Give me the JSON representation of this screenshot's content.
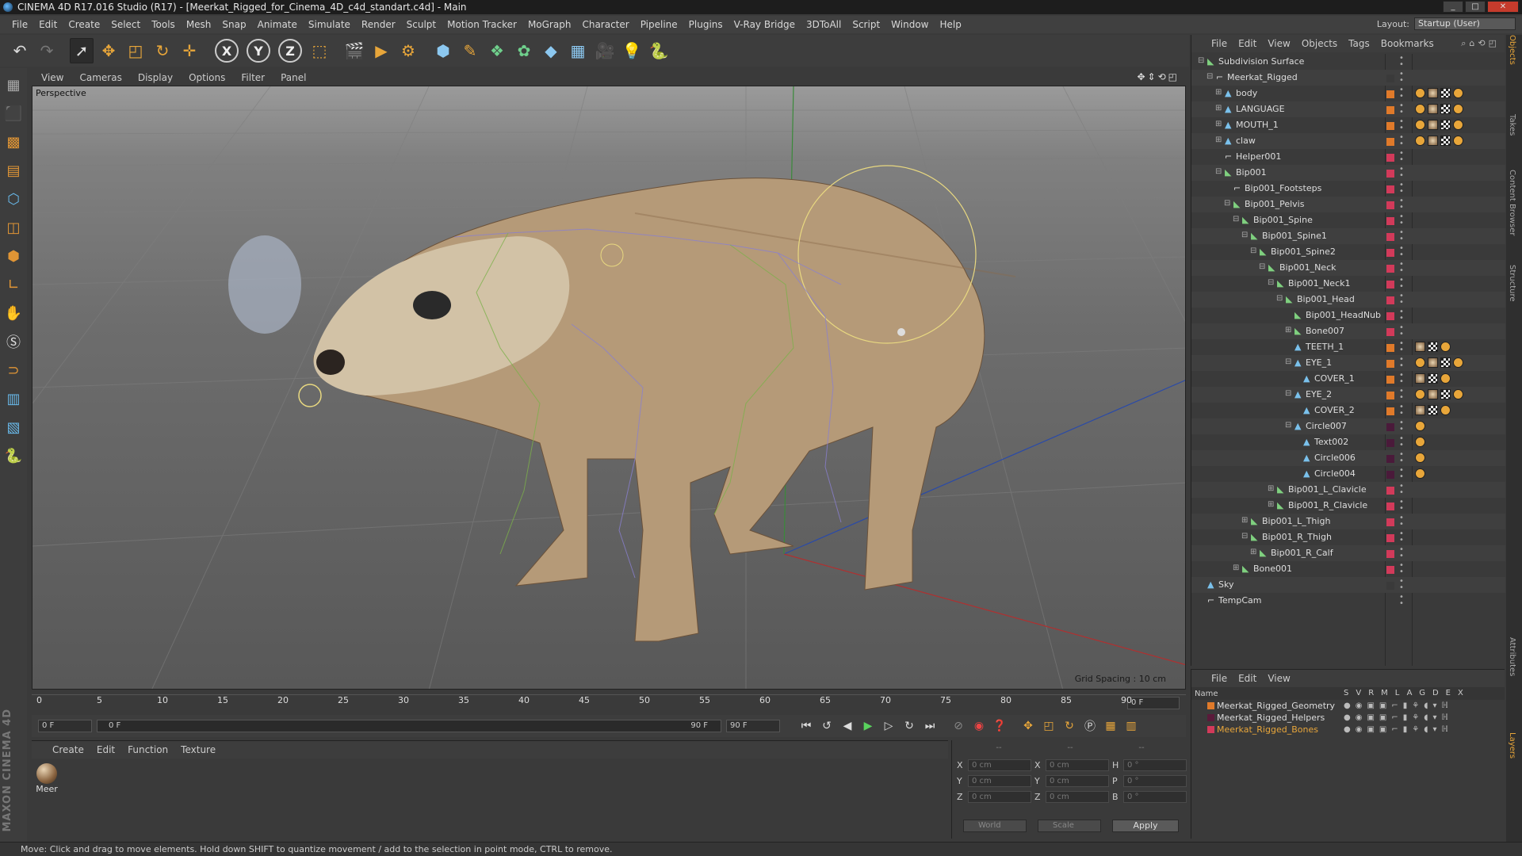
{
  "window": {
    "title": "CINEMA 4D R17.016 Studio (R17) - [Meerkat_Rigged_for_Cinema_4D_c4d_standart.c4d] - Main"
  },
  "menu": [
    "File",
    "Edit",
    "Create",
    "Select",
    "Tools",
    "Mesh",
    "Snap",
    "Animate",
    "Simulate",
    "Render",
    "Sculpt",
    "Motion Tracker",
    "MoGraph",
    "Character",
    "Pipeline",
    "Plugins",
    "V-Ray Bridge",
    "3DToAll",
    "Script",
    "Window",
    "Help"
  ],
  "layout": {
    "label": "Layout:",
    "value": "Startup (User)"
  },
  "toolbar": {
    "x": "X",
    "y": "Y",
    "z": "Z"
  },
  "viewport": {
    "menu": [
      "View",
      "Cameras",
      "Display",
      "Options",
      "Filter",
      "Panel"
    ],
    "label": "Perspective",
    "grid_spacing": "Grid Spacing : 10 cm"
  },
  "timeline": {
    "ticks": [
      "0",
      "5",
      "10",
      "15",
      "20",
      "25",
      "30",
      "35",
      "40",
      "45",
      "50",
      "55",
      "60",
      "65",
      "70",
      "75",
      "80",
      "85",
      "90"
    ],
    "current": "0 F"
  },
  "transport": {
    "start": "0 F",
    "range_start": "0 F",
    "range_end": "90 F",
    "end": "90 F"
  },
  "material": {
    "menu": [
      "Create",
      "Edit",
      "Function",
      "Texture"
    ],
    "name": "Meer"
  },
  "coords": {
    "x": "X",
    "y": "Y",
    "z": "Z",
    "h": "H",
    "p": "P",
    "b": "B",
    "pos": [
      "0 cm",
      "0 cm",
      "0 cm"
    ],
    "size": [
      "0 cm",
      "0 cm",
      "0 cm"
    ],
    "rot": [
      "0 °",
      "0 °",
      "0 °"
    ],
    "mode": "World",
    "size_mode": "Scale",
    "apply": "Apply",
    "header": [
      "--",
      "--",
      "--"
    ]
  },
  "status": "Move: Click and drag to move elements. Hold down SHIFT to quantize movement / add to the selection in point mode, CTRL to remove.",
  "brand": "MAXON CINEMA 4D",
  "objects": {
    "menu": [
      "File",
      "Edit",
      "View",
      "Objects",
      "Tags",
      "Bookmarks"
    ],
    "rows": [
      {
        "name": "Subdivision Surface",
        "depth": 0,
        "color": "#3a3a3a",
        "exp": "−",
        "icon": "green"
      },
      {
        "name": "Meerkat_Rigged",
        "depth": 1,
        "color": "#3a3a3a",
        "exp": "−",
        "icon": "white"
      },
      {
        "name": "body",
        "depth": 2,
        "color": "#e07a2a",
        "exp": "+",
        "icon": "blue",
        "tags": "mat"
      },
      {
        "name": "LANGUAGE",
        "depth": 2,
        "color": "#e07a2a",
        "exp": "+",
        "icon": "blue",
        "tags": "mat"
      },
      {
        "name": "MOUTH_1",
        "depth": 2,
        "color": "#e07a2a",
        "exp": "+",
        "icon": "blue",
        "tags": "mat"
      },
      {
        "name": "claw",
        "depth": 2,
        "color": "#e07a2a",
        "exp": "+",
        "icon": "blue",
        "tags": "mat"
      },
      {
        "name": "Helper001",
        "depth": 2,
        "color": "#d23a5a",
        "exp": "",
        "icon": "white"
      },
      {
        "name": "Bip001",
        "depth": 2,
        "color": "#d23a5a",
        "exp": "−",
        "icon": "green"
      },
      {
        "name": "Bip001_Footsteps",
        "depth": 3,
        "color": "#d23a5a",
        "exp": "",
        "icon": "white"
      },
      {
        "name": "Bip001_Pelvis",
        "depth": 3,
        "color": "#d23a5a",
        "exp": "−",
        "icon": "green"
      },
      {
        "name": "Bip001_Spine",
        "depth": 4,
        "color": "#d23a5a",
        "exp": "−",
        "icon": "green"
      },
      {
        "name": "Bip001_Spine1",
        "depth": 5,
        "color": "#d23a5a",
        "exp": "−",
        "icon": "green"
      },
      {
        "name": "Bip001_Spine2",
        "depth": 6,
        "color": "#d23a5a",
        "exp": "−",
        "icon": "green"
      },
      {
        "name": "Bip001_Neck",
        "depth": 7,
        "color": "#d23a5a",
        "exp": "−",
        "icon": "green"
      },
      {
        "name": "Bip001_Neck1",
        "depth": 8,
        "color": "#d23a5a",
        "exp": "−",
        "icon": "green"
      },
      {
        "name": "Bip001_Head",
        "depth": 9,
        "color": "#d23a5a",
        "exp": "−",
        "icon": "green"
      },
      {
        "name": "Bip001_HeadNub",
        "depth": 10,
        "color": "#d23a5a",
        "exp": "",
        "icon": "green"
      },
      {
        "name": "Bone007",
        "depth": 10,
        "color": "#d23a5a",
        "exp": "+",
        "icon": "green"
      },
      {
        "name": "TEETH_1",
        "depth": 10,
        "color": "#e07a2a",
        "exp": "",
        "icon": "blue",
        "tags": "small"
      },
      {
        "name": "EYE_1",
        "depth": 10,
        "color": "#e07a2a",
        "exp": "−",
        "icon": "blue",
        "tags": "mat"
      },
      {
        "name": "COVER_1",
        "depth": 11,
        "color": "#e07a2a",
        "exp": "",
        "icon": "blue",
        "tags": "small"
      },
      {
        "name": "EYE_2",
        "depth": 10,
        "color": "#e07a2a",
        "exp": "−",
        "icon": "blue",
        "tags": "mat"
      },
      {
        "name": "COVER_2",
        "depth": 11,
        "color": "#e07a2a",
        "exp": "",
        "icon": "blue",
        "tags": "small"
      },
      {
        "name": "Circle007",
        "depth": 10,
        "color": "#4a1a3a",
        "exp": "−",
        "icon": "blue",
        "tags": "dot"
      },
      {
        "name": "Text002",
        "depth": 11,
        "color": "#4a1a3a",
        "exp": "",
        "icon": "blue",
        "tags": "dot"
      },
      {
        "name": "Circle006",
        "depth": 11,
        "color": "#4a1a3a",
        "exp": "",
        "icon": "blue",
        "tags": "dot"
      },
      {
        "name": "Circle004",
        "depth": 11,
        "color": "#4a1a3a",
        "exp": "",
        "icon": "blue",
        "tags": "dot"
      },
      {
        "name": "Bip001_L_Clavicle",
        "depth": 8,
        "color": "#d23a5a",
        "exp": "+",
        "icon": "green"
      },
      {
        "name": "Bip001_R_Clavicle",
        "depth": 8,
        "color": "#d23a5a",
        "exp": "+",
        "icon": "green"
      },
      {
        "name": "Bip001_L_Thigh",
        "depth": 5,
        "color": "#d23a5a",
        "exp": "+",
        "icon": "green"
      },
      {
        "name": "Bip001_R_Thigh",
        "depth": 5,
        "color": "#d23a5a",
        "exp": "−",
        "icon": "green"
      },
      {
        "name": "Bip001_R_Calf",
        "depth": 6,
        "color": "#d23a5a",
        "exp": "+",
        "icon": "green"
      },
      {
        "name": "Bone001",
        "depth": 4,
        "color": "#d23a5a",
        "exp": "+",
        "icon": "green"
      },
      {
        "name": "Sky",
        "depth": 0,
        "color": "#3a3a3a",
        "exp": "",
        "icon": "blue"
      },
      {
        "name": "TempCam",
        "depth": 0,
        "color": "#3a3a3a",
        "exp": "",
        "icon": "white"
      }
    ]
  },
  "layers": {
    "menu": [
      "File",
      "Edit",
      "View"
    ],
    "name_header": "Name",
    "cols": "SVRMLAGDEX",
    "items": [
      {
        "name": "Meerkat_Rigged_Geometry",
        "color": "#e07a2a"
      },
      {
        "name": "Meerkat_Rigged_Helpers",
        "color": "#5a1a3a"
      },
      {
        "name": "Meerkat_Rigged_Bones",
        "color": "#d23a5a"
      }
    ]
  },
  "sidetabs": [
    "Objects",
    "Takes",
    "Content Browser",
    "Structure",
    "Attributes",
    "Layers"
  ]
}
